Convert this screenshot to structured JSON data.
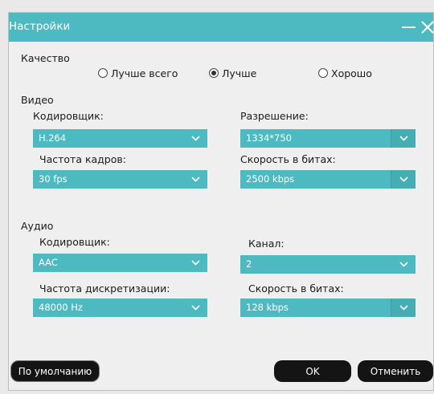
{
  "window": {
    "title": "Настройки"
  },
  "quality": {
    "label": "Качество",
    "options": [
      {
        "label": "Лучше всего",
        "checked": false
      },
      {
        "label": "Лучше",
        "checked": true
      },
      {
        "label": "Хорошо",
        "checked": false
      }
    ]
  },
  "video": {
    "label": "Видео",
    "encoder": {
      "label": "Кодировщик:",
      "value": "H.264"
    },
    "resolution": {
      "label": "Разрешение:",
      "value": "1334*750"
    },
    "framerate": {
      "label": "Частота кадров:",
      "value": "30 fps"
    },
    "bitrate": {
      "label": "Скорость в битах:",
      "value": "2500 kbps"
    }
  },
  "audio": {
    "label": "Аудио",
    "encoder": {
      "label": "Кодировщик:",
      "value": "AAC"
    },
    "channel": {
      "label": "Канал:",
      "value": "2"
    },
    "samplerate": {
      "label": "Частота дискретизации:",
      "value": "48000 Hz"
    },
    "bitrate": {
      "label": "Скорость в битах:",
      "value": "128 kbps"
    }
  },
  "buttons": {
    "default": "По умолчанию",
    "ok": "OK",
    "cancel": "Отменить"
  },
  "icons": {
    "minimize": "minimize-icon",
    "close": "close-icon",
    "dropdown": "chevron-down-icon"
  },
  "colors": {
    "accent": "#4dbac1",
    "button": "#141414"
  }
}
